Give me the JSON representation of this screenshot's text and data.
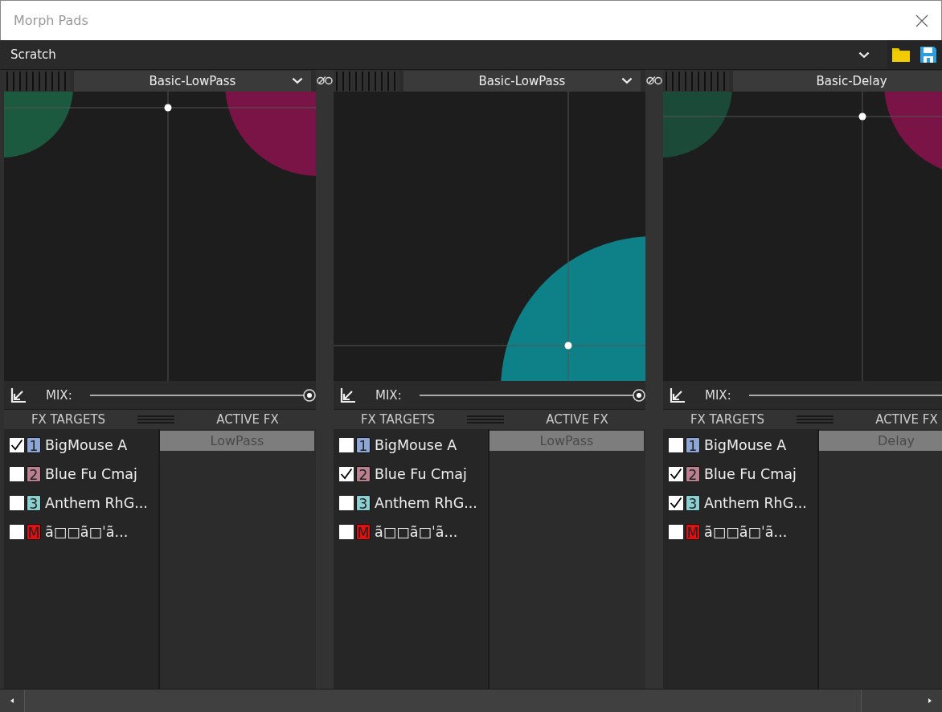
{
  "window": {
    "title": "Morph Pads"
  },
  "toolbar": {
    "preset": "Scratch"
  },
  "pads": [
    {
      "preset": "Basic-LowPass",
      "mix_label": "MIX:",
      "mix": {
        "level": 1
      },
      "targets_heading": "FX TARGETS",
      "active_heading": "ACTIVE FX",
      "targets": [
        {
          "checked": true,
          "badge": "1",
          "color": "#8ea6d6",
          "name": "BigMouse A"
        },
        {
          "checked": false,
          "badge": "2",
          "color": "#b98090",
          "name": "Blue Fu Cmaj"
        },
        {
          "checked": false,
          "badge": "3",
          "color": "#8ccfd0",
          "name": "Anthem RhG..."
        },
        {
          "checked": false,
          "badge": "M",
          "color": "#e01010",
          "name": "ã□□ã□ˈã..."
        }
      ],
      "active_fx": [
        "LowPass"
      ]
    },
    {
      "preset": "Basic-LowPass",
      "mix_label": "MIX:",
      "mix": {
        "level": 1
      },
      "targets_heading": "FX TARGETS",
      "active_heading": "ACTIVE FX",
      "targets": [
        {
          "checked": false,
          "badge": "1",
          "color": "#8ea6d6",
          "name": "BigMouse A"
        },
        {
          "checked": true,
          "badge": "2",
          "color": "#b98090",
          "name": "Blue Fu Cmaj"
        },
        {
          "checked": false,
          "badge": "3",
          "color": "#8ccfd0",
          "name": "Anthem RhG..."
        },
        {
          "checked": false,
          "badge": "M",
          "color": "#e01010",
          "name": "ã□□ã□ˈã..."
        }
      ],
      "active_fx": [
        "LowPass"
      ]
    },
    {
      "preset": "Basic-Delay",
      "mix_label": "MIX:",
      "targets_heading": "FX TARGETS",
      "active_heading": "ACTIVE FX",
      "targets": [
        {
          "checked": false,
          "badge": "1",
          "color": "#8ea6d6",
          "name": "BigMouse A"
        },
        {
          "checked": true,
          "badge": "2",
          "color": "#b98090",
          "name": "Blue Fu Cmaj"
        },
        {
          "checked": true,
          "badge": "3",
          "color": "#8ccfd0",
          "name": "Anthem RhG..."
        },
        {
          "checked": false,
          "badge": "M",
          "color": "#e01010",
          "name": "ã□□ã□ˈã..."
        }
      ],
      "active_fx": [
        "Delay"
      ]
    }
  ]
}
